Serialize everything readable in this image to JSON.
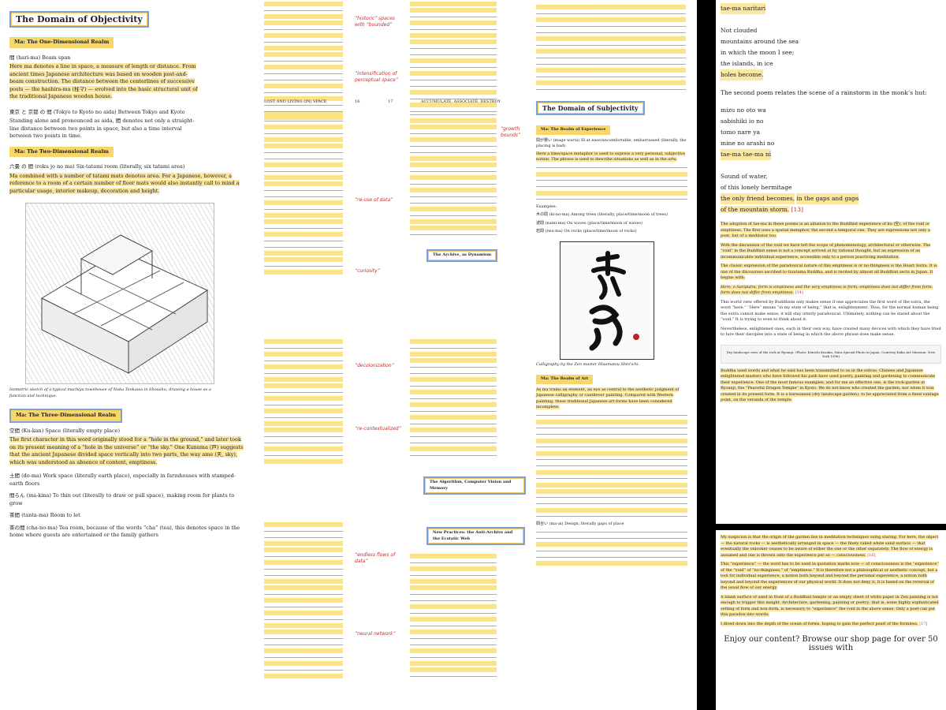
{
  "panel1": {
    "title": "The Domain of Objectivity",
    "ma1": {
      "heading": "Ma: The One-Dimensional Realm",
      "term": "間 (hari-ma) Beam span",
      "text": "Here ma denotes a line in space, a measure of length or distance. From ancient times Japanese architecture was based on wooden post-and-beam construction. The distance between the centerlines of successive posts — the hashira-ma (柱マ) — evolved into the basic structural unit of the traditional Japanese wooden house."
    },
    "term2": "東京 と 京都 の 間 (Tokyo to Kyoto no aida) Between Tokyo and Kyoto",
    "term2_text": "Standing alone and pronounced as aida, 間 denotes not only a straight-line distance between two points in space, but also a time interval between two points in time.",
    "ma2": {
      "heading": "Ma: The Two-Dimensional Realm",
      "term": "六畳 の 間 (roku jo no ma) Six-tatami room (literally, six tatami area)",
      "text": "Ma combined with a number of tatami mats denotes area. For a Japanese, however, a reference to a room of a certain number of floor mats would also instantly call to mind a particular usage, interior makeup, decoration and height."
    },
    "figure_caption": "Isometric sketch of a typical machiya townhouse of Naka Tenkawa in Shoushu, drawing a house as a function and technique.",
    "ma3": {
      "heading": "Ma: The Three-Dimensional Realm",
      "term": "空間 (Ku-kan) Space (literally empty place)",
      "text": "The first character in this word originally stood for a “hole in the ground,” and later took on its present meaning of a “hole in the universe” or “the sky.” One Kunuma (戸) suggests that the ancient Japanese divided space vertically into two parts, the way ame (天, sky), which was understood as absence of content, emptiness."
    },
    "tail_terms": [
      "土間 (do-ma) Work space (literally earth place), especially in farmhouses with stamped-earth floors",
      "間らん (ma-kina) To thin out (literally to draw or pull space), making room for plants to grow",
      "茶間 (tanta-ma) Room to let",
      "茶の間 (cha-no-ma) Tea room, because of the words “cha” (tea), this denotes space in the home where guests are entertained or the family gathers"
    ]
  },
  "panel2": {
    "footer1_left": "LOST AND LIVING (IN) SPACE",
    "footer1_right": "ACCUMULATE, ASSOCIATE, DESTROY",
    "page_left": "16",
    "page_right": "17",
    "sub1": "The Archive, as Dynamism",
    "sub2": "The Algorithm, Computer Vision and Memory",
    "sub3": "New Practices: the Anti-Archive and the Ecstatic Web",
    "notes": [
      "“historic” spaces with “bounded”",
      "“intensification of perceptual space”",
      "“structuring design + subversive”",
      "“re-use of data”",
      "“growth bounds”",
      "“curiosity”",
      "“essay”",
      "“decolonization”",
      "“re-contextualized”",
      "“perceptual shift”",
      "“endless flows of data”",
      "“neural network”"
    ]
  },
  "panel3": {
    "title": "The Domain of Subjectivity",
    "ma1": {
      "heading": "Ma: The Realm of Experience",
      "term": "間が悪い (mage warui) Ill at ease/uncomfortable, embarrassed (literally, the placing is bad)",
      "text": "Here a time/space metaphor is used to express a very personal, subjective notion. The phrase is used to describe situations as well as in the arts."
    },
    "examples_label": "Examples:",
    "example1": "木の間 (ki-no-ma) Among trees (literally, place/time/moon of trees)",
    "example2": "波間 (nami-ma) On waves (place/time/moon of waves)",
    "example3": "岩間 (iwa-ma) On rocks (place/time/moon of rocks)",
    "calligraphy_caption": "Calligraphy by the Zen master Hisamatsu Shin'ichi.",
    "ma2": {
      "heading": "Ma: The Realm of Art",
      "text": "As ma trains an element, an eye as central to the aesthetic judgment of Japanese calligraphy or cantilever painting. Compared with Western painting, these traditional Japanese art forms have been considered incomplete."
    },
    "term_bottom": "間合い (ma-ai) Design, literally gaps of place"
  },
  "panel4": {
    "poem1": [
      "tae-ma naritari",
      "",
      "Not clouded",
      "mountains around the sea",
      "in which the moon I see;",
      "the islands, in ice",
      "holes become."
    ],
    "para1": "The second poem relates the scene of a rainstorm in the monk’s hut:",
    "poem2": [
      "mizu no oto wa",
      "sabishiki io no",
      "tomo nare ya",
      "mine no arashi no",
      "tae-ma tae-ma ni",
      "",
      "Sound of water,",
      "of this lonely hermitage",
      "the only friend becomes,",
      "in the gaps and gaps",
      "of the mountain storm."
    ],
    "poem2_ref": "[13]",
    "para2": "The adoption of tae-ma in these poems is an allusion to the Buddhist experience of ku (空), of the void or emptiness. The first uses a spatial metaphor, the second a temporal one. They are expressions not only a poet, but of a meditator too.",
    "para3": "With the discussion of the void we have left the scope of phenomenology, architectural or otherwise. The “void” in the Buddhist sense is not a concept arrived at by rational thought, but an expression of an incommunicable individual experience, accessible only to a person practicing meditation.",
    "para4": "The classic expression of the paradoxical nature of this emptiness is or no-thingness is the Heart Sutra. It is one of the discourses ascribed to Gautama Buddha, and is recited by almost all Buddhist sects in Japan. It begins with:",
    "quote": "Here, o Sariputra, form is emptiness and the very emptiness is form; emptiness does not differ from form, form does not differ from emptiness.",
    "quote_ref": "[14]",
    "para5": "This world view offered by Buddhism only makes sense if one appreciates the first word of the sutra, the word “here.” “Here” means “in my state of being,” that is, enlightenment. Thus, for the normal human being the sutra cannot make sense; it will stay utterly paradoxical. Ultimately, nothing can be stated about the “void.” It is trying to even to think about it.",
    "para6": "Nevertheless, enlightened ones, each in their own way, have created many devices with which they have tried to lure their disciples into a state of being in which the above phrase does make sense.",
    "caption": "Dry landscape view of the rock at Ryoanji. (Photo: Kenichi Karuko, Nara Special Photo in Japan, Courtesy Kaku Art Museum, New York 1998)",
    "para7": "Buddha used words and what he said has been transmitted to us in the sutras. Chinese and Japanese enlightened masters who have followed his path have used poetry, painting and gardening to communicate their experience. One of the most famous examples, and for me an effective one, is the rock-garden at Ryoanji, the “Peaceful Dragon Temple” in Kyoto. We do not know who created the garden, nor when it was created in its present form. It is a karesansui (dry landscape garden), to be appreciated from a fixed vantage point, on the veranda of the temple."
  },
  "panel5": {
    "para1": "My suspicion is that the origin of the garden lies in meditation techniques using staring. For here, the object — the natural rocks — is aesthetically arranged in space — the finely raked white sand surface — that eventually the onlooker ceases to be aware of either the one or the other separately. The flow of energy is assumed and one is thrown onto the experience per se — consciousness.",
    "ref1": "[16]",
    "para2": "This “experience” — the word has to be used in quotation marks now — of consciousness is the “experience” of the “void” of “no-thingness,” of “emptiness.” It is therefore not a philosophical or aesthetic concept, but a tool for individual experience, a notion both beyond and beyond the personal experience, a notion both beyond and beyond the experiences of our physical world. It does not deny it, it is based on the reversal of the usual flow of our energy.",
    "para3": "A blank surface of sand in front of a Buddhist temple or an empty sheet of white paper in Zen painting is not enough to trigger this insight. Architecture, gardening, painting or poetry; that is, some highly sophisticated setting of form and non-form, is necessary to “experience” the void in the above sense. Only a poet can put this paradox into words:",
    "para4": "I dived down into the depth of the ocean of forms, hoping to gain the perfect pearl of the formless.",
    "ref2": "[17]",
    "enjoy": "Enjoy our content? Browse our shop page for over 50 issues with"
  },
  "colors": {
    "highlight": "#fbe7a1",
    "highlight_strong": "#f7d66a",
    "annotation_red": "#c23030",
    "title_box_blue": "#7aa2d6"
  }
}
